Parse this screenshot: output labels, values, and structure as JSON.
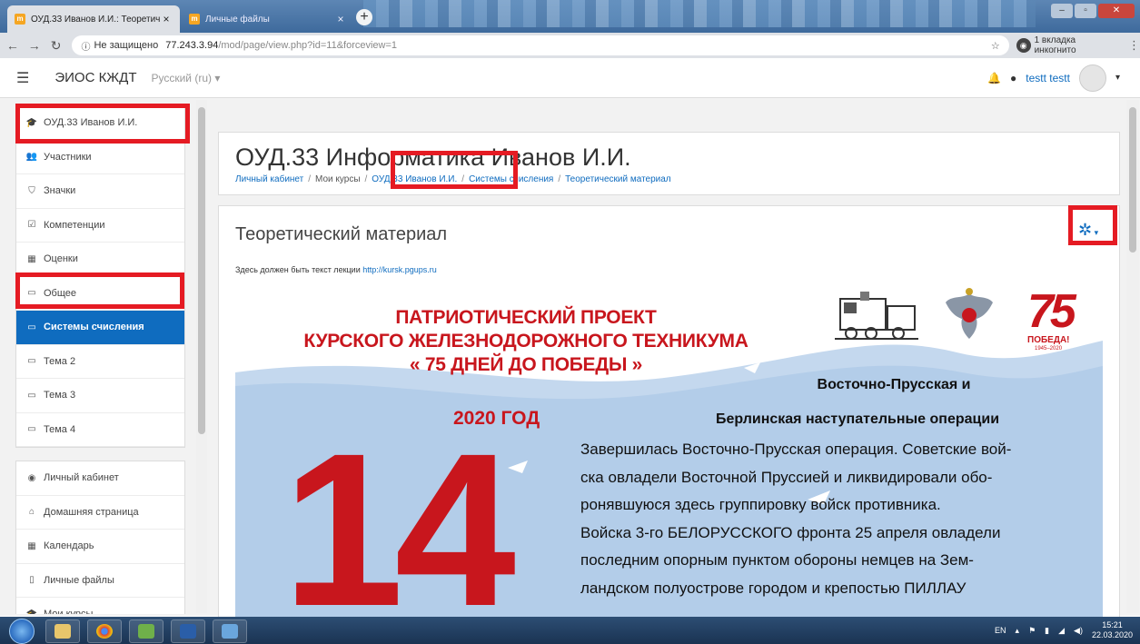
{
  "browser": {
    "tabs": [
      {
        "title": "ОУД.33 Иванов И.И.: Теоретич",
        "active": true
      },
      {
        "title": "Личные файлы",
        "active": false
      }
    ],
    "new_tab": "+",
    "close": "×",
    "url_secure_label": "Не защищено",
    "url_host": "77.243.3.94",
    "url_path": "/mod/page/view.php?id=11&forceview=1",
    "incognito_label": "1 вкладка инкогнито"
  },
  "navbar": {
    "site_name": "ЭИОС КЖДТ",
    "language": "Русский (ru) ▾",
    "user_name": "testt testt"
  },
  "sidebar": {
    "course_items": [
      {
        "label": "ОУД.33 Иванов И.И.",
        "icon": "graduation-cap-icon",
        "glyph": "🎓"
      },
      {
        "label": "Участники",
        "icon": "users-icon",
        "glyph": "👥"
      },
      {
        "label": "Значки",
        "icon": "shield-icon",
        "glyph": "⛉"
      },
      {
        "label": "Компетенции",
        "icon": "checkbox-icon",
        "glyph": "☑"
      },
      {
        "label": "Оценки",
        "icon": "table-icon",
        "glyph": "▦"
      },
      {
        "label": "Общее",
        "icon": "folder-icon",
        "glyph": "▭"
      },
      {
        "label": "Системы счисления",
        "icon": "folder-icon",
        "glyph": "▭",
        "active": true
      },
      {
        "label": "Тема 2",
        "icon": "folder-icon",
        "glyph": "▭"
      },
      {
        "label": "Тема 3",
        "icon": "folder-icon",
        "glyph": "▭"
      },
      {
        "label": "Тема 4",
        "icon": "folder-icon",
        "glyph": "▭"
      }
    ],
    "site_items": [
      {
        "label": "Личный кабинет",
        "icon": "dashboard-icon",
        "glyph": "◉"
      },
      {
        "label": "Домашняя страница",
        "icon": "home-icon",
        "glyph": "⌂"
      },
      {
        "label": "Календарь",
        "icon": "calendar-icon",
        "glyph": "▦"
      },
      {
        "label": "Личные файлы",
        "icon": "file-icon",
        "glyph": "▯"
      },
      {
        "label": "Мои курсы",
        "icon": "graduation-cap-icon",
        "glyph": "🎓"
      }
    ]
  },
  "course": {
    "title": "ОУД.33 Информатика Иванов И.И.",
    "breadcrumbs": [
      "Личный кабинет",
      "Мои курсы",
      "ОУД.33 Иванов И.И.",
      "Системы счисления",
      "Теоретический материал"
    ]
  },
  "page": {
    "heading": "Теоретический материал",
    "lecture_text": "Здесь должен быть текст лекции ",
    "lecture_link": "http://kursk.pgups.ru"
  },
  "poster": {
    "title_lines": [
      "ПАТРИОТИЧЕСКИЙ ПРОЕКТ",
      "КУРСКОГО ЖЕЛЕЗНОДОРОЖНОГО ТЕХНИКУМА",
      "« 75 ДНЕЙ ДО ПОБЕДЫ »"
    ],
    "year": "2020 ГОД",
    "day_number": "14",
    "heading_line1": "Восточно-Прусская и",
    "heading_line2": "Берлинская наступательные операции",
    "body_lines": [
      "Завершилась Восточно-Прусская операция. Советские вой-",
      "ска овладели Восточной Пруссией и ликвидировали обо-",
      "ронявшуюся здесь группировку войск противника.",
      "Войска 3-го БЕЛОРУССКОГО фронта 25 апреля овладели",
      "последним опорным пунктом обороны немцев на Зем-",
      "ландском полуострове городом и крепостью ПИЛЛАУ"
    ],
    "emblem_75": "75",
    "emblem_pobeda": "ПОБЕДА!",
    "emblem_years": "1945–2020"
  },
  "taskbar": {
    "lang": "EN",
    "time": "15:21",
    "date": "22.03.2020"
  },
  "colors": {
    "accent": "#0f6cbf",
    "highlight": "#e51b23",
    "poster_red": "#c8161d"
  }
}
